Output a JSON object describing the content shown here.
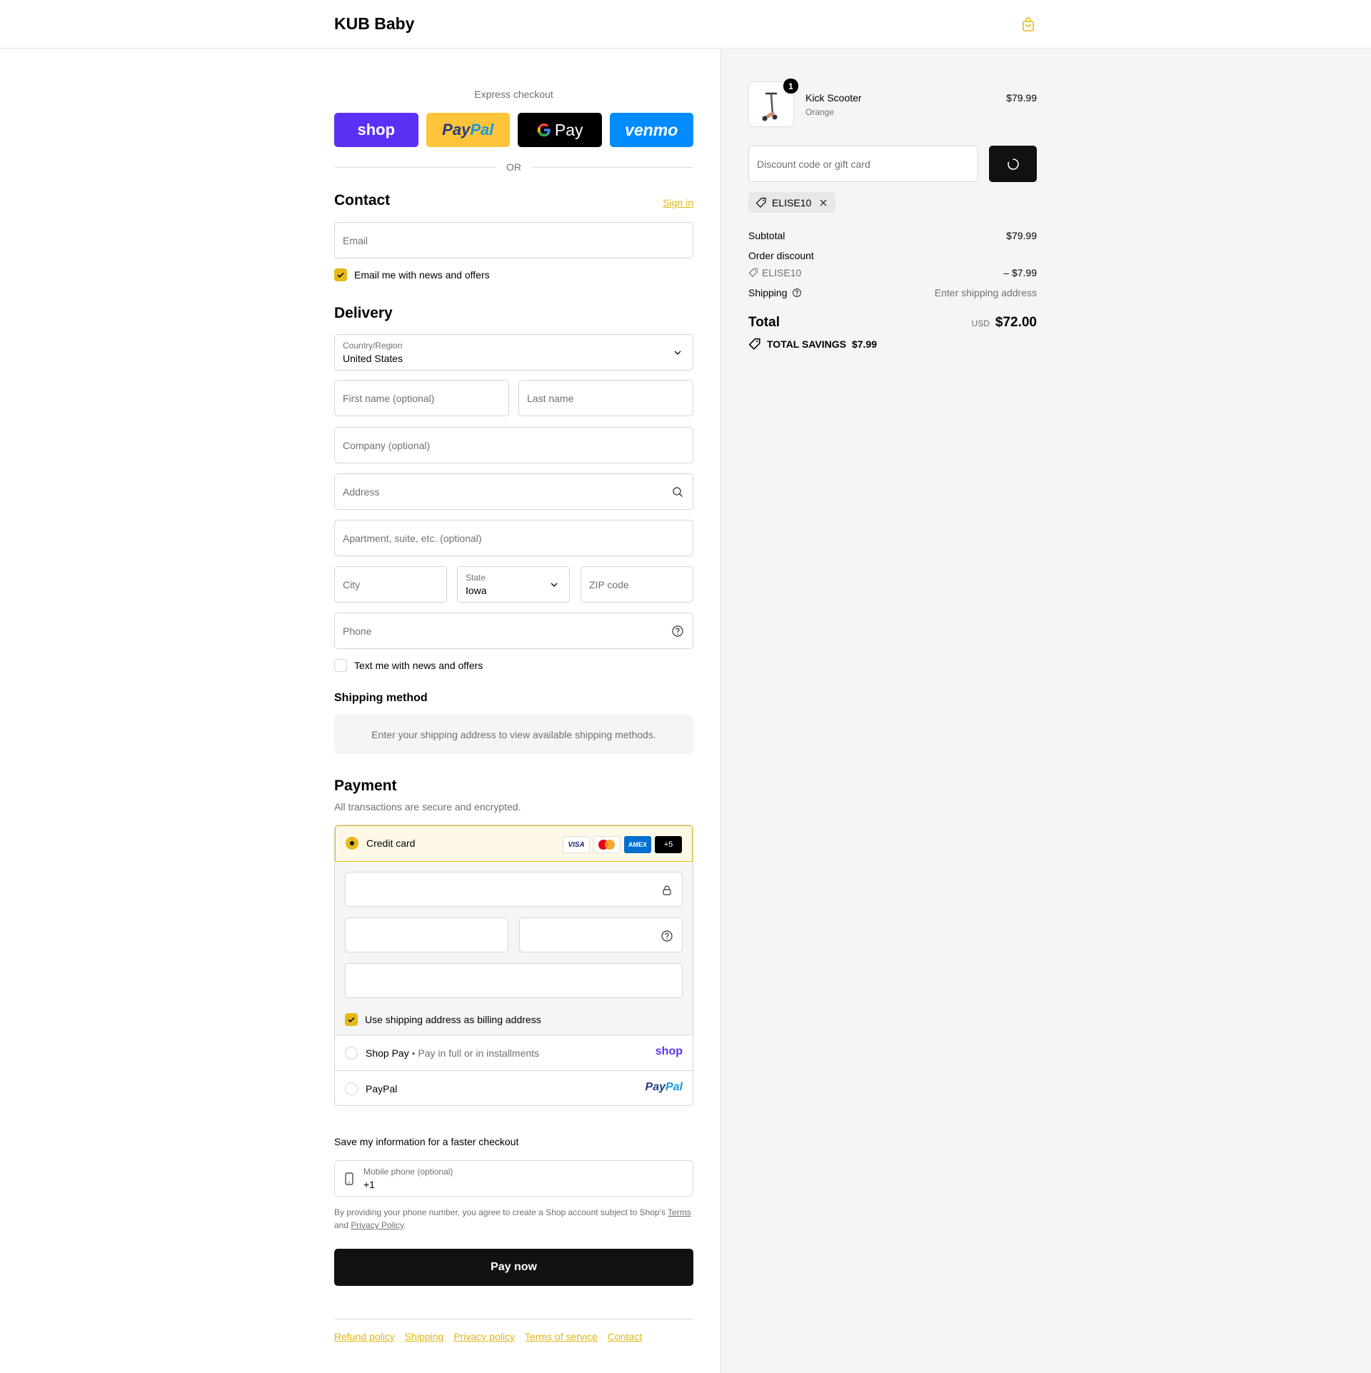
{
  "header": {
    "brand": "KUB Baby",
    "cart_icon": "shopping-bag-icon"
  },
  "express": {
    "label": "Express checkout",
    "shop": "shop",
    "paypal_a": "Pay",
    "paypal_b": "Pal",
    "gpay": "Pay",
    "venmo": "venmo",
    "or": "OR"
  },
  "contact": {
    "title": "Contact",
    "sign_in": "Sign in",
    "email_placeholder": "Email",
    "newsletter_label": "Email me with news and offers",
    "newsletter_checked": true
  },
  "delivery": {
    "title": "Delivery",
    "country_label": "Country/Region",
    "country_value": "United States",
    "first_name_placeholder": "First name (optional)",
    "last_name_placeholder": "Last name",
    "company_placeholder": "Company (optional)",
    "address_placeholder": "Address",
    "apartment_placeholder": "Apartment, suite, etc. (optional)",
    "city_placeholder": "City",
    "state_label": "State",
    "state_value": "Iowa",
    "zip_placeholder": "ZIP code",
    "phone_placeholder": "Phone",
    "sms_label": "Text me with news and offers",
    "sms_checked": false
  },
  "shipping": {
    "title": "Shipping method",
    "notice": "Enter your shipping address to view available shipping methods."
  },
  "payment": {
    "title": "Payment",
    "subtitle": "All transactions are secure and encrypted.",
    "credit_card_label": "Credit card",
    "cards": {
      "visa": "VISA",
      "amex": "AMEX",
      "more": "+5"
    },
    "billing_label": "Use shipping address as billing address",
    "billing_checked": true,
    "shop_pay_label": "Shop Pay",
    "shop_pay_sub": "Pay in full or in installments",
    "shop_pay_brand": "shop",
    "paypal_label": "PayPal",
    "paypal_brand_a": "Pay",
    "paypal_brand_b": "Pal"
  },
  "save_info": {
    "title": "Save my information for a faster checkout",
    "mobile_label": "Mobile phone (optional)",
    "mobile_value": "+1",
    "terms_prefix": "By providing your phone number, you agree to create a Shop account subject to Shop's",
    "terms_link": "Terms",
    "terms_and": "and",
    "privacy_link": "Privacy Policy",
    "terms_end": "."
  },
  "pay_now": "Pay now",
  "footer": [
    "Refund policy",
    "Shipping",
    "Privacy policy",
    "Terms of service",
    "Contact"
  ],
  "summary": {
    "item": {
      "name": "Kick Scooter",
      "variant": "Orange",
      "price": "$79.99",
      "qty": "1"
    },
    "discount_placeholder": "Discount code or gift card",
    "applied_code": "ELISE10",
    "subtotal_label": "Subtotal",
    "subtotal_value": "$79.99",
    "order_discount_label": "Order discount",
    "discount_code": "ELISE10",
    "discount_value": "– $7.99",
    "shipping_label": "Shipping",
    "shipping_value": "Enter shipping address",
    "total_label": "Total",
    "currency": "USD",
    "total_value": "$72.00",
    "savings_label": "TOTAL SAVINGS",
    "savings_value": "$7.99"
  },
  "colors": {
    "accent": "#e6b918",
    "dark": "#111111",
    "shop_purple": "#5a31f4",
    "paypal_yellow": "#ffc439",
    "venmo_blue": "#008cff"
  }
}
